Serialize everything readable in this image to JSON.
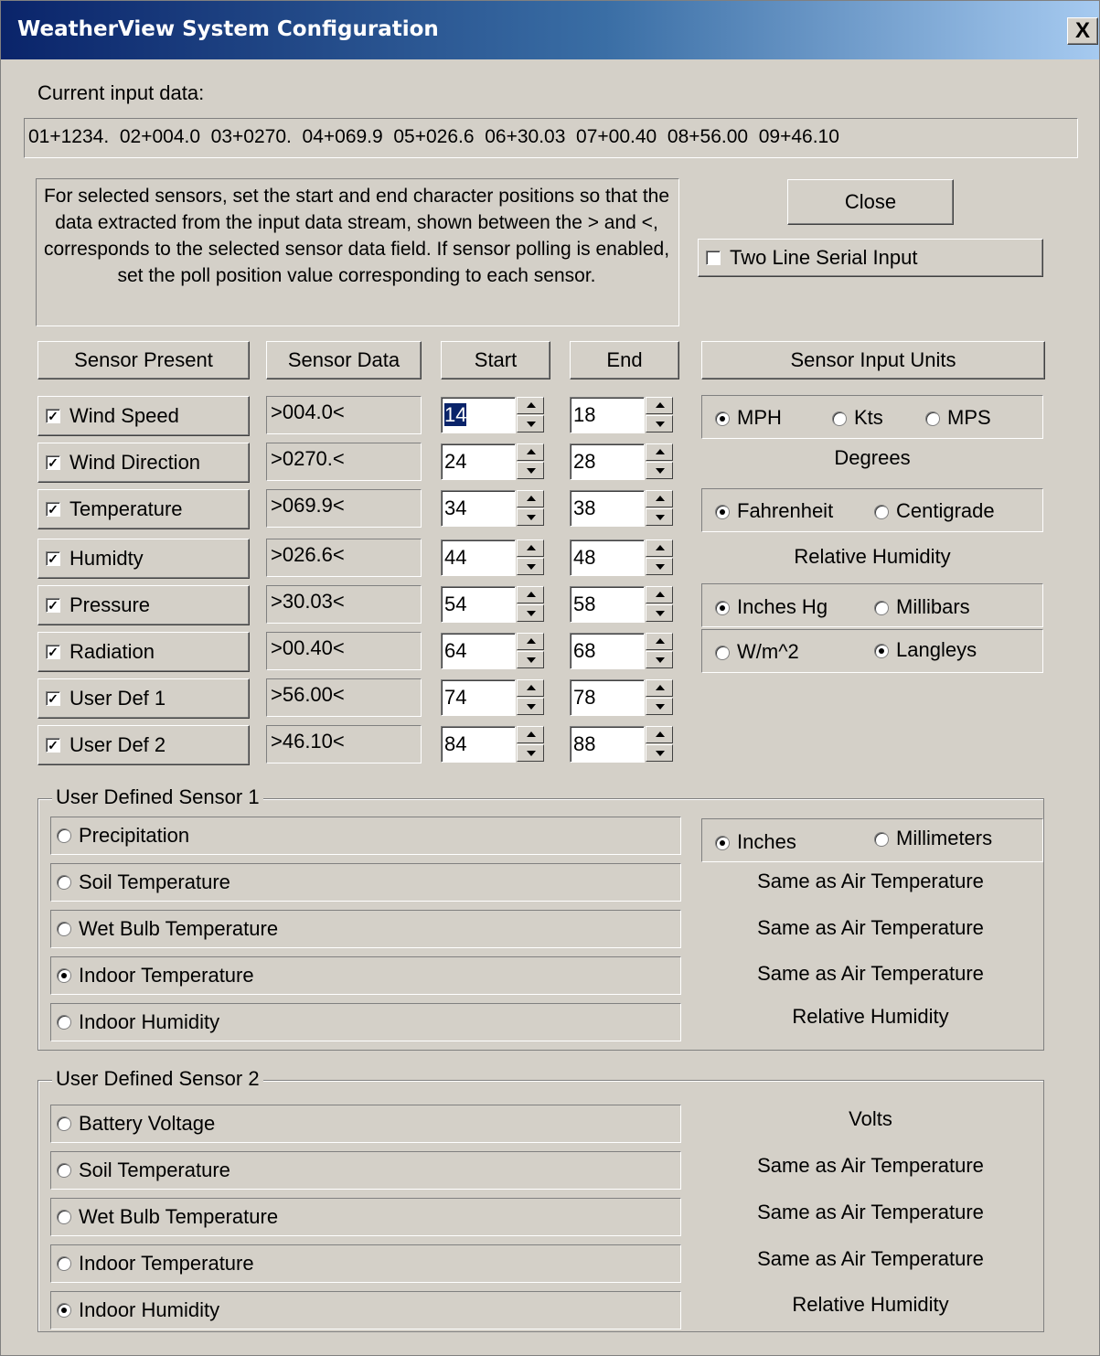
{
  "window": {
    "title": "WeatherView System Configuration",
    "close_glyph": "X"
  },
  "input": {
    "label": "Current input data:",
    "value": "01+1234.  02+004.0  03+0270.  04+069.9  05+026.6  06+30.03  07+00.40  08+56.00  09+46.10"
  },
  "instructions": "For selected sensors, set the start and end character positions so that the data extracted from the input data stream, shown between the > and <, corresponds to the selected sensor data field. If sensor polling is enabled, set the poll position value corresponding to each sensor.",
  "close_label": "Close",
  "two_line": {
    "label": "Two Line Serial Input",
    "checked": false
  },
  "headers": {
    "present": "Sensor Present",
    "data": "Sensor Data",
    "start": "Start",
    "end": "End",
    "units": "Sensor Input Units"
  },
  "sensors": [
    {
      "name": "Wind Speed",
      "checked": true,
      "data": ">004.0<",
      "start": "14",
      "end": "18"
    },
    {
      "name": "Wind Direction",
      "checked": true,
      "data": ">0270.<",
      "start": "24",
      "end": "28"
    },
    {
      "name": "Temperature",
      "checked": true,
      "data": ">069.9<",
      "start": "34",
      "end": "38"
    },
    {
      "name": "Humidty",
      "checked": true,
      "data": ">026.6<",
      "start": "44",
      "end": "48"
    },
    {
      "name": "Pressure",
      "checked": true,
      "data": ">30.03<",
      "start": "54",
      "end": "58"
    },
    {
      "name": "Radiation",
      "checked": true,
      "data": ">00.40<",
      "start": "64",
      "end": "68"
    },
    {
      "name": "User Def 1",
      "checked": true,
      "data": ">56.00<",
      "start": "74",
      "end": "78"
    },
    {
      "name": "User Def 2",
      "checked": true,
      "data": ">46.10<",
      "start": "84",
      "end": "88"
    }
  ],
  "units": {
    "wind": {
      "mph": "MPH",
      "kts": "Kts",
      "mps": "MPS",
      "selected": "MPH"
    },
    "direction": "Degrees",
    "temp": {
      "f": "Fahrenheit",
      "c": "Centigrade",
      "selected": "Fahrenheit"
    },
    "humidity": "Relative Humidity",
    "pressure": {
      "inhg": "Inches Hg",
      "mb": "Millibars",
      "selected": "Inches Hg"
    },
    "radiation": {
      "wm2": "W/m^2",
      "ly": "Langleys",
      "selected": "Langleys"
    }
  },
  "user1": {
    "title": "User Defined Sensor 1",
    "options": [
      {
        "label": "Precipitation",
        "selected": false
      },
      {
        "label": "Soil Temperature",
        "selected": false
      },
      {
        "label": "Wet Bulb Temperature",
        "selected": false
      },
      {
        "label": "Indoor Temperature",
        "selected": true
      },
      {
        "label": "Indoor Humidity",
        "selected": false
      }
    ],
    "precip_units": {
      "in": "Inches",
      "mm": "Millimeters",
      "selected": "Inches"
    },
    "notes": [
      "Same as Air Temperature",
      "Same as Air Temperature",
      "Same as Air Temperature",
      "Relative Humidity"
    ]
  },
  "user2": {
    "title": "User Defined Sensor 2",
    "options": [
      {
        "label": "Battery Voltage",
        "selected": false
      },
      {
        "label": "Soil Temperature",
        "selected": false
      },
      {
        "label": "Wet Bulb Temperature",
        "selected": false
      },
      {
        "label": "Indoor Temperature",
        "selected": false
      },
      {
        "label": "Indoor Humidity",
        "selected": true
      }
    ],
    "notes": [
      "Volts",
      "Same as Air Temperature",
      "Same as Air Temperature",
      "Same as Air Temperature",
      "Relative Humidity"
    ]
  }
}
